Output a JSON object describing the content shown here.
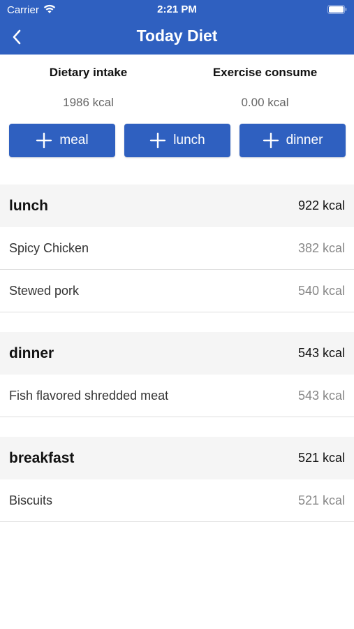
{
  "status_bar": {
    "carrier": "Carrier",
    "time": "2:21 PM"
  },
  "header": {
    "title": "Today Diet",
    "background": "#2f60c0"
  },
  "summary": {
    "intake_label": "Dietary intake",
    "intake_value": "1986 kcal",
    "exercise_label": "Exercise consume",
    "exercise_value": "0.00 kcal"
  },
  "add_buttons": [
    {
      "label": "meal"
    },
    {
      "label": "lunch"
    },
    {
      "label": "dinner"
    }
  ],
  "sections": [
    {
      "name": "lunch",
      "total": "922 kcal",
      "items": [
        {
          "name": "Spicy Chicken",
          "kcal": "382 kcal"
        },
        {
          "name": "Stewed pork",
          "kcal": "540 kcal"
        }
      ]
    },
    {
      "name": "dinner",
      "total": "543 kcal",
      "items": [
        {
          "name": "Fish flavored shredded meat",
          "kcal": "543 kcal"
        }
      ]
    },
    {
      "name": "breakfast",
      "total": "521 kcal",
      "items": [
        {
          "name": "Biscuits",
          "kcal": "521 kcal"
        }
      ]
    }
  ],
  "icons": {
    "back": "chevron-left-icon",
    "add": "plus-icon",
    "wifi": "wifi-icon",
    "battery": "battery-icon"
  }
}
